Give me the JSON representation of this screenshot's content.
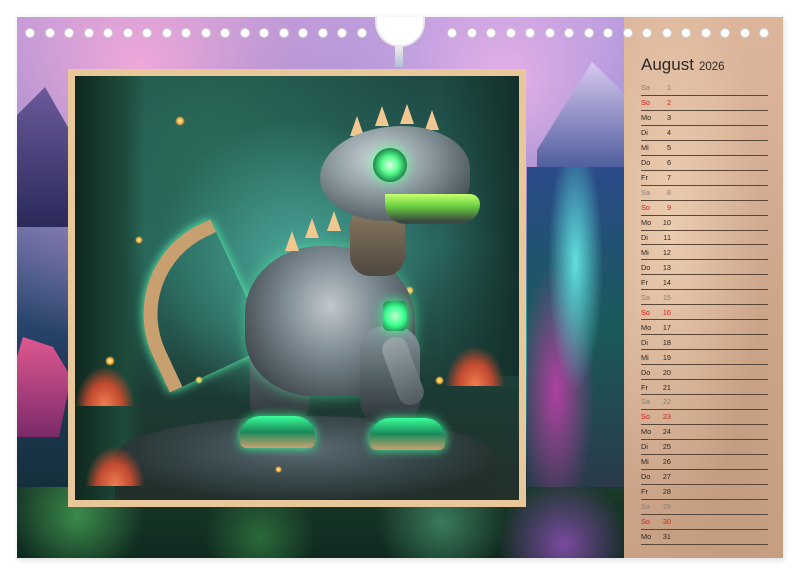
{
  "calendar": {
    "month": "August",
    "year": "2026",
    "days": [
      {
        "name": "Sa",
        "num": "1",
        "type": "sat"
      },
      {
        "name": "So",
        "num": "2",
        "type": "sun"
      },
      {
        "name": "Mo",
        "num": "3",
        "type": "weekday"
      },
      {
        "name": "Di",
        "num": "4",
        "type": "weekday"
      },
      {
        "name": "Mi",
        "num": "5",
        "type": "weekday"
      },
      {
        "name": "Do",
        "num": "6",
        "type": "weekday"
      },
      {
        "name": "Fr",
        "num": "7",
        "type": "weekday"
      },
      {
        "name": "Sa",
        "num": "8",
        "type": "sat"
      },
      {
        "name": "So",
        "num": "9",
        "type": "sun"
      },
      {
        "name": "Mo",
        "num": "10",
        "type": "weekday"
      },
      {
        "name": "Di",
        "num": "11",
        "type": "weekday"
      },
      {
        "name": "Mi",
        "num": "12",
        "type": "weekday"
      },
      {
        "name": "Do",
        "num": "13",
        "type": "weekday"
      },
      {
        "name": "Fr",
        "num": "14",
        "type": "weekday"
      },
      {
        "name": "Sa",
        "num": "15",
        "type": "sat"
      },
      {
        "name": "So",
        "num": "16",
        "type": "sun"
      },
      {
        "name": "Mo",
        "num": "17",
        "type": "weekday"
      },
      {
        "name": "Di",
        "num": "18",
        "type": "weekday"
      },
      {
        "name": "Mi",
        "num": "19",
        "type": "weekday"
      },
      {
        "name": "Do",
        "num": "20",
        "type": "weekday"
      },
      {
        "name": "Fr",
        "num": "21",
        "type": "weekday"
      },
      {
        "name": "Sa",
        "num": "22",
        "type": "sat"
      },
      {
        "name": "So",
        "num": "23",
        "type": "sun"
      },
      {
        "name": "Mo",
        "num": "24",
        "type": "weekday"
      },
      {
        "name": "Di",
        "num": "25",
        "type": "weekday"
      },
      {
        "name": "Mi",
        "num": "26",
        "type": "weekday"
      },
      {
        "name": "Do",
        "num": "27",
        "type": "weekday"
      },
      {
        "name": "Fr",
        "num": "28",
        "type": "weekday"
      },
      {
        "name": "Sa",
        "num": "29",
        "type": "sat"
      },
      {
        "name": "So",
        "num": "30",
        "type": "sun"
      },
      {
        "name": "Mo",
        "num": "31",
        "type": "weekday"
      }
    ]
  },
  "colors": {
    "panel_bg": "#d4ad92",
    "sunday": "#d0221a",
    "saturday": "#8a7e74",
    "weekday": "#2a2420",
    "frame": "#e8c89a"
  },
  "photo": {
    "subject": "robot-dinosaur-illustration"
  }
}
